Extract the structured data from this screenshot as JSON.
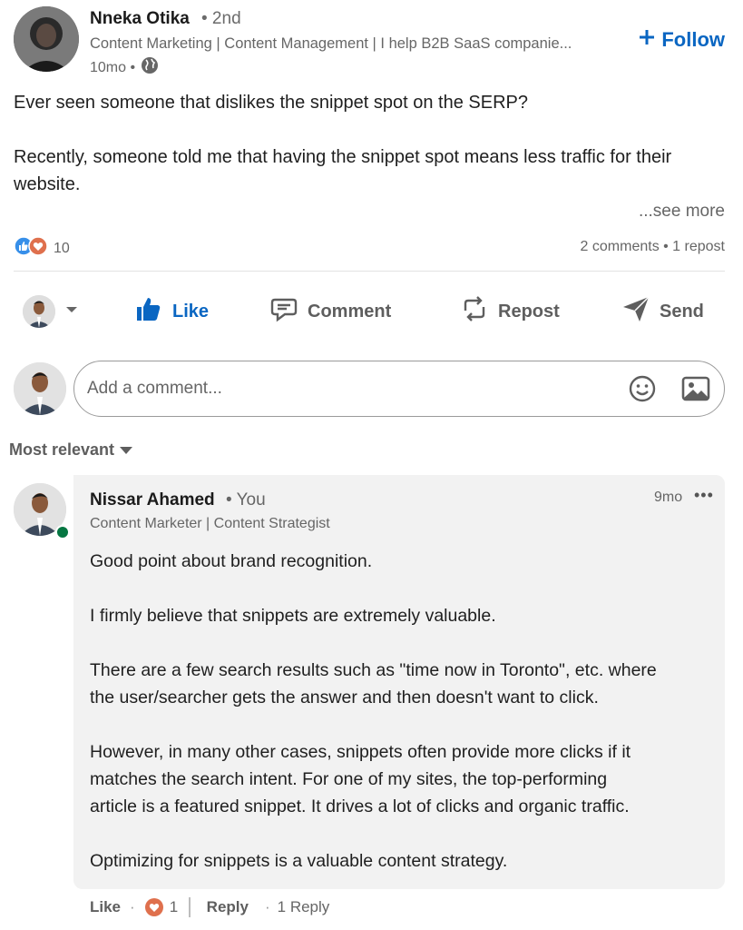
{
  "post": {
    "author_name": "Nneka Otika",
    "author_degree": "• 2nd",
    "author_headline": "Content Marketing | Content Management | I help B2B SaaS companie...",
    "time_ago": "10mo •",
    "follow_label": "Follow",
    "text_line_1": "Ever seen someone that dislikes the snippet spot on the SERP?",
    "text_line_2": "Recently, someone told me that having the snippet spot means less traffic for their",
    "text_line_3": "website.",
    "see_more": "...see more",
    "reaction_count": "10",
    "social_counts": "2 comments • 1 repost"
  },
  "actions": {
    "like": "Like",
    "comment": "Comment",
    "repost": "Repost",
    "send": "Send"
  },
  "comment_input": {
    "placeholder": "Add a comment..."
  },
  "sort_label": "Most relevant",
  "comment": {
    "author_name": "Nissar Ahamed",
    "author_tag": "• You",
    "author_headline": "Content Marketer | Content Strategist",
    "time_ago": "9mo",
    "more": "•••",
    "lines": [
      "Good point about brand recognition.",
      "I firmly believe that snippets are extremely valuable.",
      "There are a few search results such as \"time now in Toronto\", etc. where",
      "the user/searcher gets the answer and then doesn't want to click.",
      "However, in many other cases, snippets often provide more clicks if it",
      "matches the search intent. For one of my sites, the top-performing",
      "article is a featured snippet. It drives a lot of clicks and organic traffic.",
      "Optimizing for snippets is a valuable content strategy."
    ],
    "like_label": "Like",
    "like_sep": "·",
    "reaction_count": "1",
    "reply_label": "Reply",
    "reply_sep": "·",
    "reply_count": "1 Reply"
  },
  "colors": {
    "accent": "#0a66c2",
    "online": "#057642",
    "love": "#df704d",
    "comment_bg": "#f2f2f2"
  },
  "icons": [
    "globe-icon",
    "plus-icon",
    "like-reaction-icon",
    "love-reaction-icon",
    "chevron-down-icon",
    "thumbs-up-icon",
    "comment-icon",
    "repost-icon",
    "send-icon",
    "emoji-icon",
    "image-icon",
    "caret-down-icon",
    "online-status-icon",
    "heart-icon"
  ]
}
